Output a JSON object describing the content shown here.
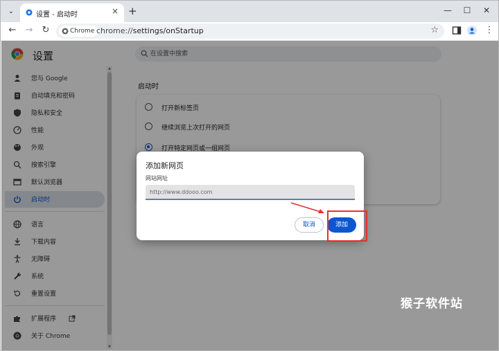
{
  "browser": {
    "tab_title": "设置 - 启动时",
    "chip_label": "Chrome",
    "url_scheme": "chrome://",
    "url_path": "settings/onStartup"
  },
  "settings": {
    "title": "设置",
    "search_placeholder": "在设置中搜索",
    "nav": [
      {
        "label": "您与 Google",
        "icon": "person-icon"
      },
      {
        "label": "自动填充和密码",
        "icon": "clipboard-icon"
      },
      {
        "label": "隐私和安全",
        "icon": "shield-icon"
      },
      {
        "label": "性能",
        "icon": "gauge-icon"
      },
      {
        "label": "外观",
        "icon": "palette-icon"
      },
      {
        "label": "搜索引擎",
        "icon": "search-icon"
      },
      {
        "label": "默认浏览器",
        "icon": "browser-icon"
      },
      {
        "label": "启动时",
        "icon": "power-icon",
        "active": true
      },
      {
        "label": "语言",
        "icon": "globe-icon"
      },
      {
        "label": "下载内容",
        "icon": "download-icon"
      },
      {
        "label": "无障碍",
        "icon": "accessibility-icon"
      },
      {
        "label": "系统",
        "icon": "wrench-icon"
      },
      {
        "label": "重置设置",
        "icon": "reset-icon"
      },
      {
        "label": "扩展程序",
        "icon": "puzzle-icon"
      },
      {
        "label": "关于 Chrome",
        "icon": "chrome-icon"
      }
    ],
    "section_title": "启动时",
    "options": [
      {
        "label": "打开新标签页",
        "checked": false
      },
      {
        "label": "继续浏览上次打开的网页",
        "checked": false
      },
      {
        "label": "打开特定网页或一组网页",
        "checked": true
      }
    ]
  },
  "dialog": {
    "title": "添加新网页",
    "field_label": "网站网址",
    "field_placeholder": "http://www.ddooo.com",
    "cancel_label": "取消",
    "add_label": "添加"
  },
  "watermark": "猴子软件站",
  "colors": {
    "accent": "#0b57d0",
    "annotation_red": "#e03131",
    "overlay": "rgba(0,0,0,0.40)"
  }
}
